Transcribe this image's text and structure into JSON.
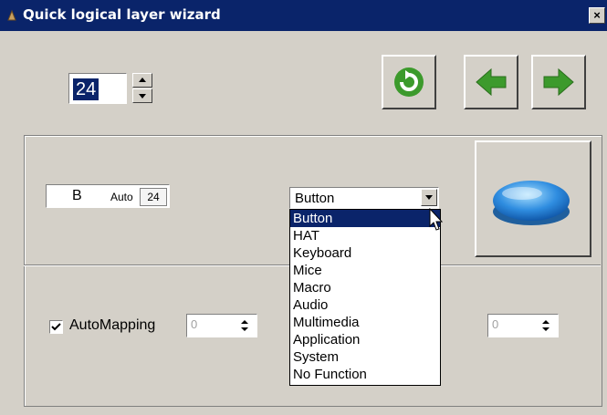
{
  "window": {
    "title": "Quick logical layer wizard",
    "close_label": "×"
  },
  "layer_spinner": {
    "value": "24"
  },
  "toolbar": {
    "refresh_icon": "refresh-icon",
    "back_icon": "arrow-left-icon",
    "forward_icon": "arrow-right-icon"
  },
  "button_field": {
    "letter": "B",
    "auto_label": "Auto",
    "auto_value": "24"
  },
  "type_combo": {
    "selected": "Button",
    "options": [
      "Button",
      "HAT",
      "Keyboard",
      "Mice",
      "Macro",
      "Audio",
      "Multimedia",
      "Application",
      "System",
      "No Function"
    ]
  },
  "automapping": {
    "label": "AutoMapping",
    "checked": true
  },
  "left_number": {
    "value": "0"
  },
  "right_number": {
    "value": "0"
  },
  "colors": {
    "titlebar": "#0a246a",
    "selection": "#0a246a",
    "arrow_green": "#3c9a2c",
    "button_blue": "#2f8de0"
  }
}
